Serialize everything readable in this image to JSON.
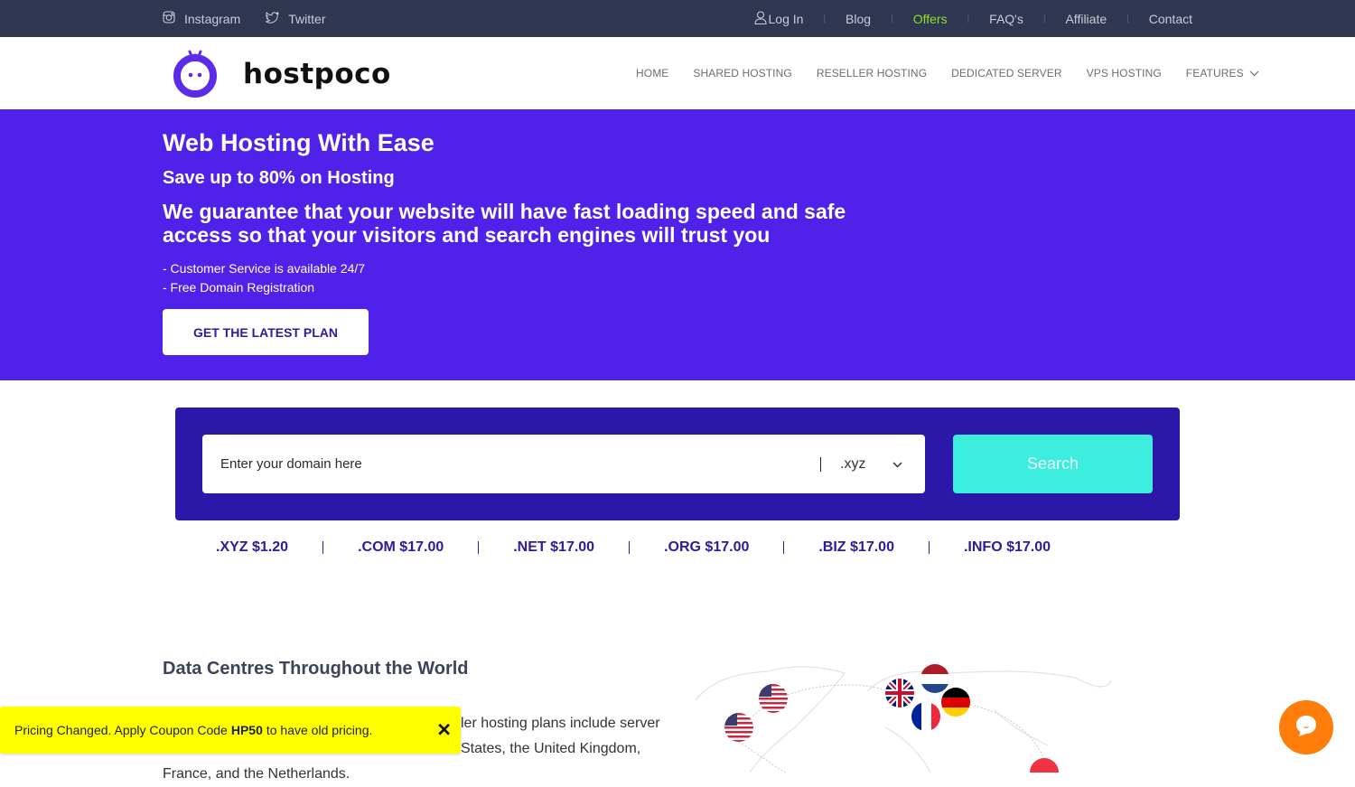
{
  "topbar": {
    "social": [
      {
        "label": "Instagram",
        "icon": "instagram-icon"
      },
      {
        "label": "Twitter",
        "icon": "twitter-icon"
      }
    ],
    "links": [
      {
        "label": "Log In",
        "icon": "user-icon"
      },
      {
        "label": "Blog"
      },
      {
        "label": "Offers",
        "highlight": true
      },
      {
        "label": "FAQ's"
      },
      {
        "label": "Affiliate"
      },
      {
        "label": "Contact"
      }
    ],
    "separator": "|"
  },
  "header": {
    "brand": "hostpoco",
    "nav": [
      {
        "label": "HOME"
      },
      {
        "label": "SHARED HOSTING"
      },
      {
        "label": "RESELLER HOSTING"
      },
      {
        "label": "DEDICATED SERVER"
      },
      {
        "label": "VPS HOSTING"
      },
      {
        "label": "FEATURES",
        "has_dropdown": true
      }
    ]
  },
  "hero": {
    "title": "Web Hosting With Ease",
    "subtitle": "Save up to 80% on Hosting",
    "tagline": "We guarantee that your website will have fast loading speed and safe access so that your visitors and search engines will trust you",
    "features": [
      "- Customer Service is available 24/7",
      "- Free Domain Registration"
    ],
    "cta_label": "GET THE LATEST PLAN"
  },
  "domain_search": {
    "placeholder": "Enter your domain here",
    "value": "",
    "selected_tld": ".xyz",
    "search_label": "Search",
    "prices": [
      {
        "tld": ".XYZ",
        "price": "$1.20"
      },
      {
        "tld": ".COM",
        "price": "$17.00"
      },
      {
        "tld": ".NET",
        "price": "$17.00"
      },
      {
        "tld": ".ORG",
        "price": "$17.00"
      },
      {
        "tld": ".BIZ",
        "price": "$17.00"
      },
      {
        "tld": ".INFO",
        "price": "$17.00"
      }
    ]
  },
  "data_centres": {
    "title": "Data Centres Throughout the World",
    "visible_fragments": [
      "ler hosting plans include server",
      "States, the United Kingdom,",
      "France, and the Netherlands."
    ],
    "flags": [
      "United States",
      "United States",
      "United Kingdom",
      "Netherlands",
      "Germany",
      "France",
      "Singapore"
    ]
  },
  "coupon_banner": {
    "prefix": "Pricing Changed. Apply Coupon Code",
    "code": "HP50",
    "suffix": "to have old pricing.",
    "close_label": "✕"
  },
  "colors": {
    "topbar_bg": "#2f3650",
    "hero_bg": "#5021e8",
    "search_box_bg": "#2c18a8",
    "search_button": "#3deddd",
    "offers_link": "#8ee02a",
    "coupon_bg": "#ffff00",
    "chat_button": "#ff7d0a"
  }
}
